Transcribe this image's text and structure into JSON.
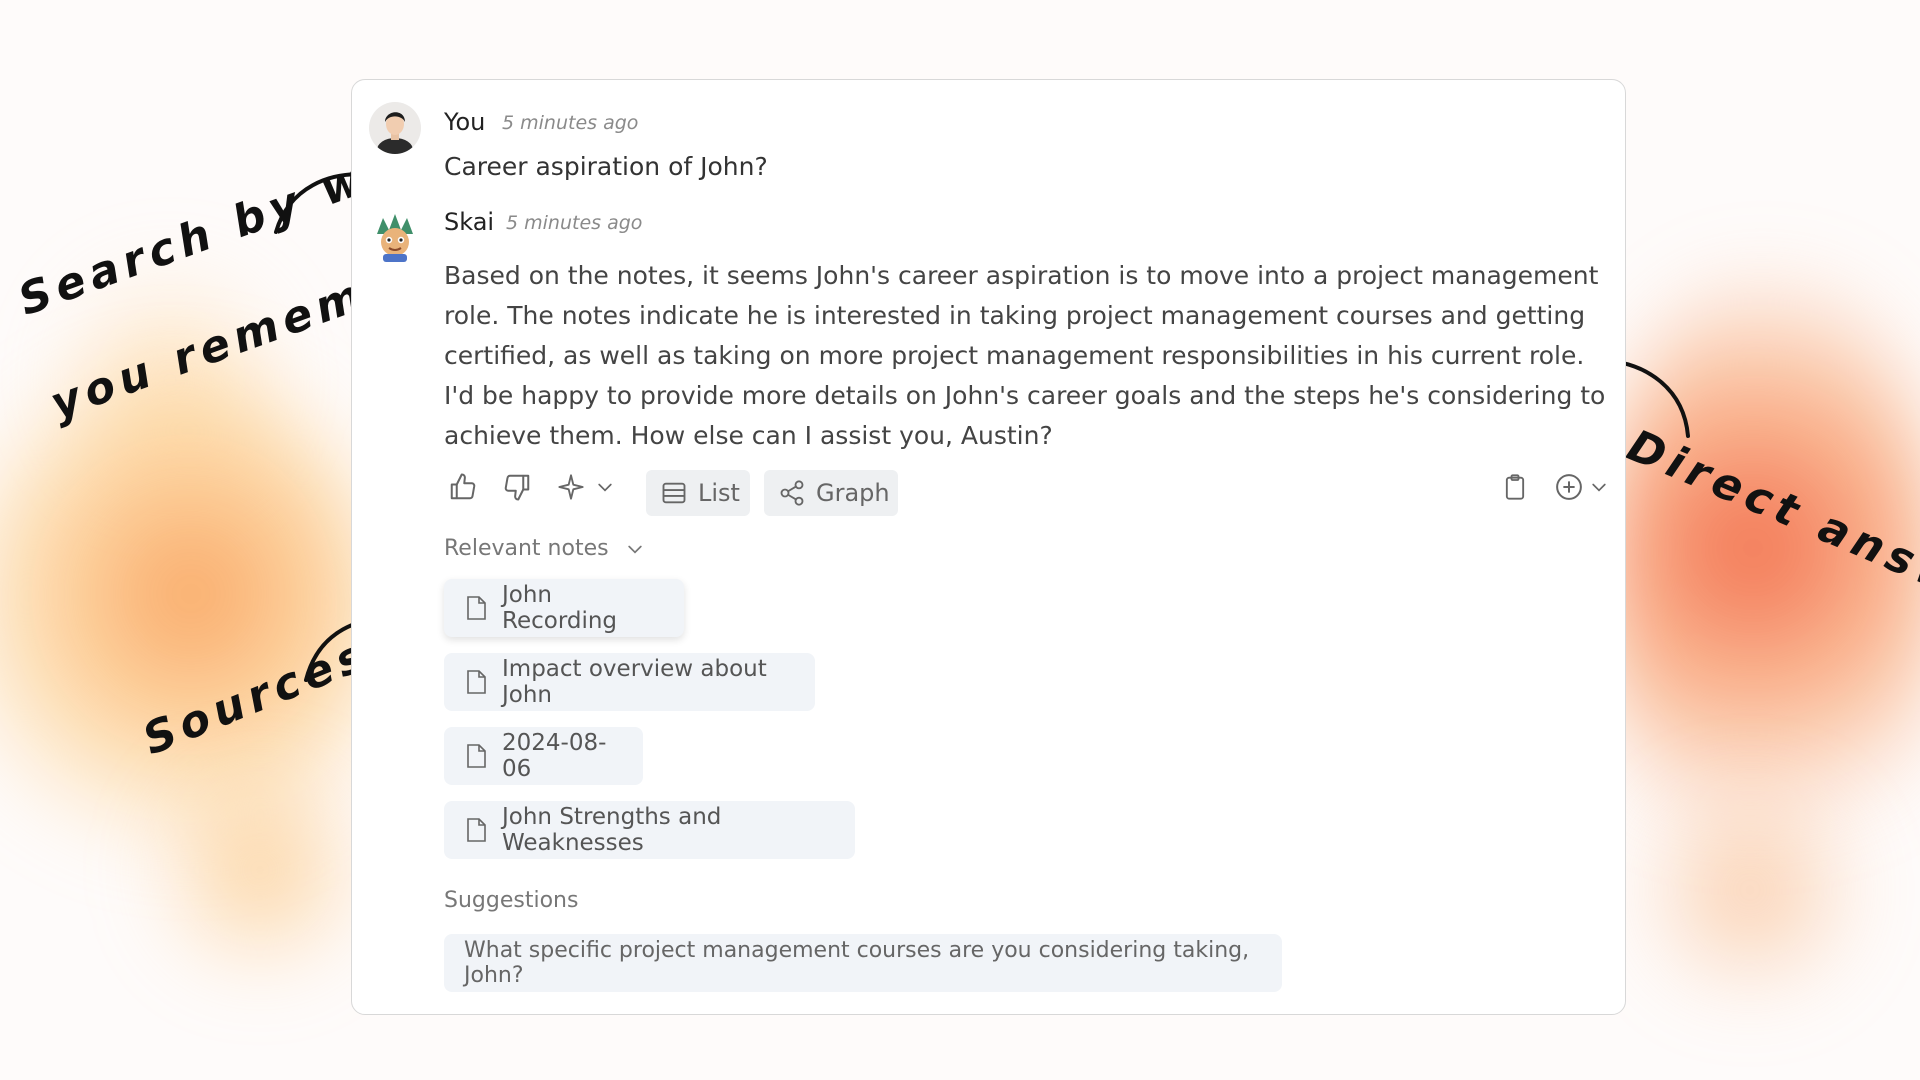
{
  "annotations": {
    "search_line1": "Search by what",
    "search_line2": "you remember",
    "sources": "Sources",
    "direct_answer": "Direct answer"
  },
  "chat": {
    "user": {
      "name": "You",
      "time": "5 minutes ago",
      "message": "Career aspiration of John?"
    },
    "assistant": {
      "name": "Skai",
      "time": "5 minutes ago",
      "message": "Based on the notes, it seems John's career aspiration is to move into a project management role. The notes indicate he is interested in taking project management courses and getting certified, as well as taking on more project management responsibilities in his current role. I'd be happy to provide more details on John's career goals and the steps he's considering to achieve them. How else can I assist you, Austin?"
    }
  },
  "toolbar": {
    "list_label": "List",
    "graph_label": "Graph",
    "icons": [
      "thumbs-up-icon",
      "thumbs-down-icon",
      "sparkle-icon",
      "chevron-down-icon",
      "list-icon",
      "share-graph-icon",
      "clipboard-icon",
      "plus-circle-icon",
      "chevron-down-icon"
    ]
  },
  "relevant_notes": {
    "label": "Relevant notes",
    "items": [
      {
        "title": "John Recording"
      },
      {
        "title": "Impact overview about John"
      },
      {
        "title": "2024-08-06"
      },
      {
        "title": "John Strengths and Weaknesses"
      }
    ]
  },
  "suggestions": {
    "label": "Suggestions",
    "items": [
      {
        "text": "What specific project management courses are you considering taking, John?"
      }
    ]
  },
  "colors": {
    "accent_orange": "#f5893f",
    "accent_red": "#ef5a36",
    "chip_bg": "#f1f4f8"
  }
}
